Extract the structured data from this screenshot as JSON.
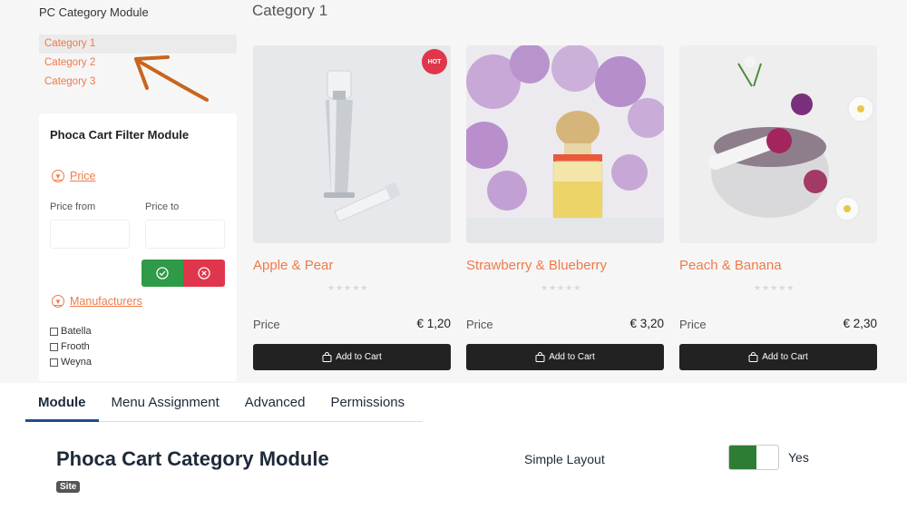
{
  "left": {
    "module_title": "PC Category Module",
    "categories": [
      {
        "label": "Category 1"
      },
      {
        "label": "Category 2"
      },
      {
        "label": "Category 3"
      }
    ]
  },
  "filter": {
    "title": "Phoca Cart Filter Module",
    "price_section": "Price",
    "price_from_label": "Price from",
    "price_to_label": "Price to",
    "price_from_value": "",
    "price_to_value": "",
    "manufacturers_section": "Manufacturers",
    "manufacturers": [
      {
        "label": "Batella"
      },
      {
        "label": "Frooth"
      },
      {
        "label": "Weyna"
      }
    ]
  },
  "main": {
    "title": "Category 1",
    "products": [
      {
        "name": "Apple & Pear",
        "price_label": "Price",
        "price": "€ 1,20",
        "badge": "HOT",
        "add_label": "Add to Cart",
        "stars": "★★★★★"
      },
      {
        "name": "Strawberry & Blueberry",
        "price_label": "Price",
        "price": "€ 3,20",
        "badge": "",
        "add_label": "Add to Cart",
        "stars": "★★★★★"
      },
      {
        "name": "Peach & Banana",
        "price_label": "Price",
        "price": "€ 2,30",
        "badge": "",
        "add_label": "Add to Cart",
        "stars": "★★★★★"
      }
    ]
  },
  "tabs": [
    {
      "label": "Module"
    },
    {
      "label": "Menu Assignment"
    },
    {
      "label": "Advanced"
    },
    {
      "label": "Permissions"
    }
  ],
  "module": {
    "title": "Phoca Cart Category Module",
    "badge": "Site",
    "option_label": "Simple Layout",
    "option_value": "Yes"
  },
  "colors": {
    "accent": "#f07a4a",
    "ok": "#2f9a47",
    "cancel": "#e0364b",
    "toggle_on": "#2d7d34"
  }
}
